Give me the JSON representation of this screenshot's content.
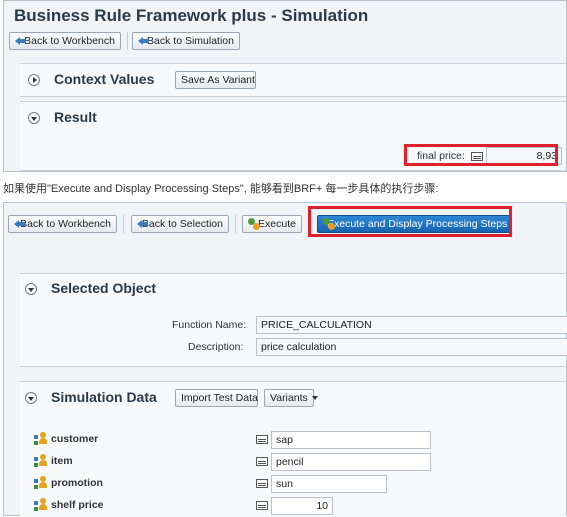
{
  "panel1": {
    "title": "Business Rule Framework plus - Simulation",
    "toolbar": {
      "back_workbench": "Back to Workbench",
      "back_simulation": "Back to Simulation"
    },
    "context": {
      "title": "Context Values",
      "save_variant": "Save As Variant"
    },
    "result": {
      "title": "Result",
      "final_price_label": "final price:",
      "final_price_value": "8,93"
    }
  },
  "caption": "如果使用\"Execute and Display Processing Steps\", 能够看到BRF+ 每一步具体的执行步骤:",
  "panel2": {
    "toolbar": {
      "back_workbench": "Back to Workbench",
      "back_selection": "Back to Selection",
      "execute": "Execute",
      "execute_display": "Execute and Display Processing Steps"
    },
    "selected_object": {
      "title": "Selected Object",
      "function_name_label": "Function Name:",
      "function_name_value": "PRICE_CALCULATION",
      "description_label": "Description:",
      "description_value": "price calculation"
    },
    "simulation": {
      "title": "Simulation Data",
      "import_label": "Import Test Data",
      "variants_label": "Variants",
      "params": [
        {
          "name": "customer",
          "value": "sap"
        },
        {
          "name": "item",
          "value": "pencil"
        },
        {
          "name": "promotion",
          "value": "sun"
        },
        {
          "name": "shelf price",
          "value": "10"
        }
      ]
    }
  },
  "colors": {
    "highlight": "#e0202a",
    "primary_button": "#1664ad"
  }
}
